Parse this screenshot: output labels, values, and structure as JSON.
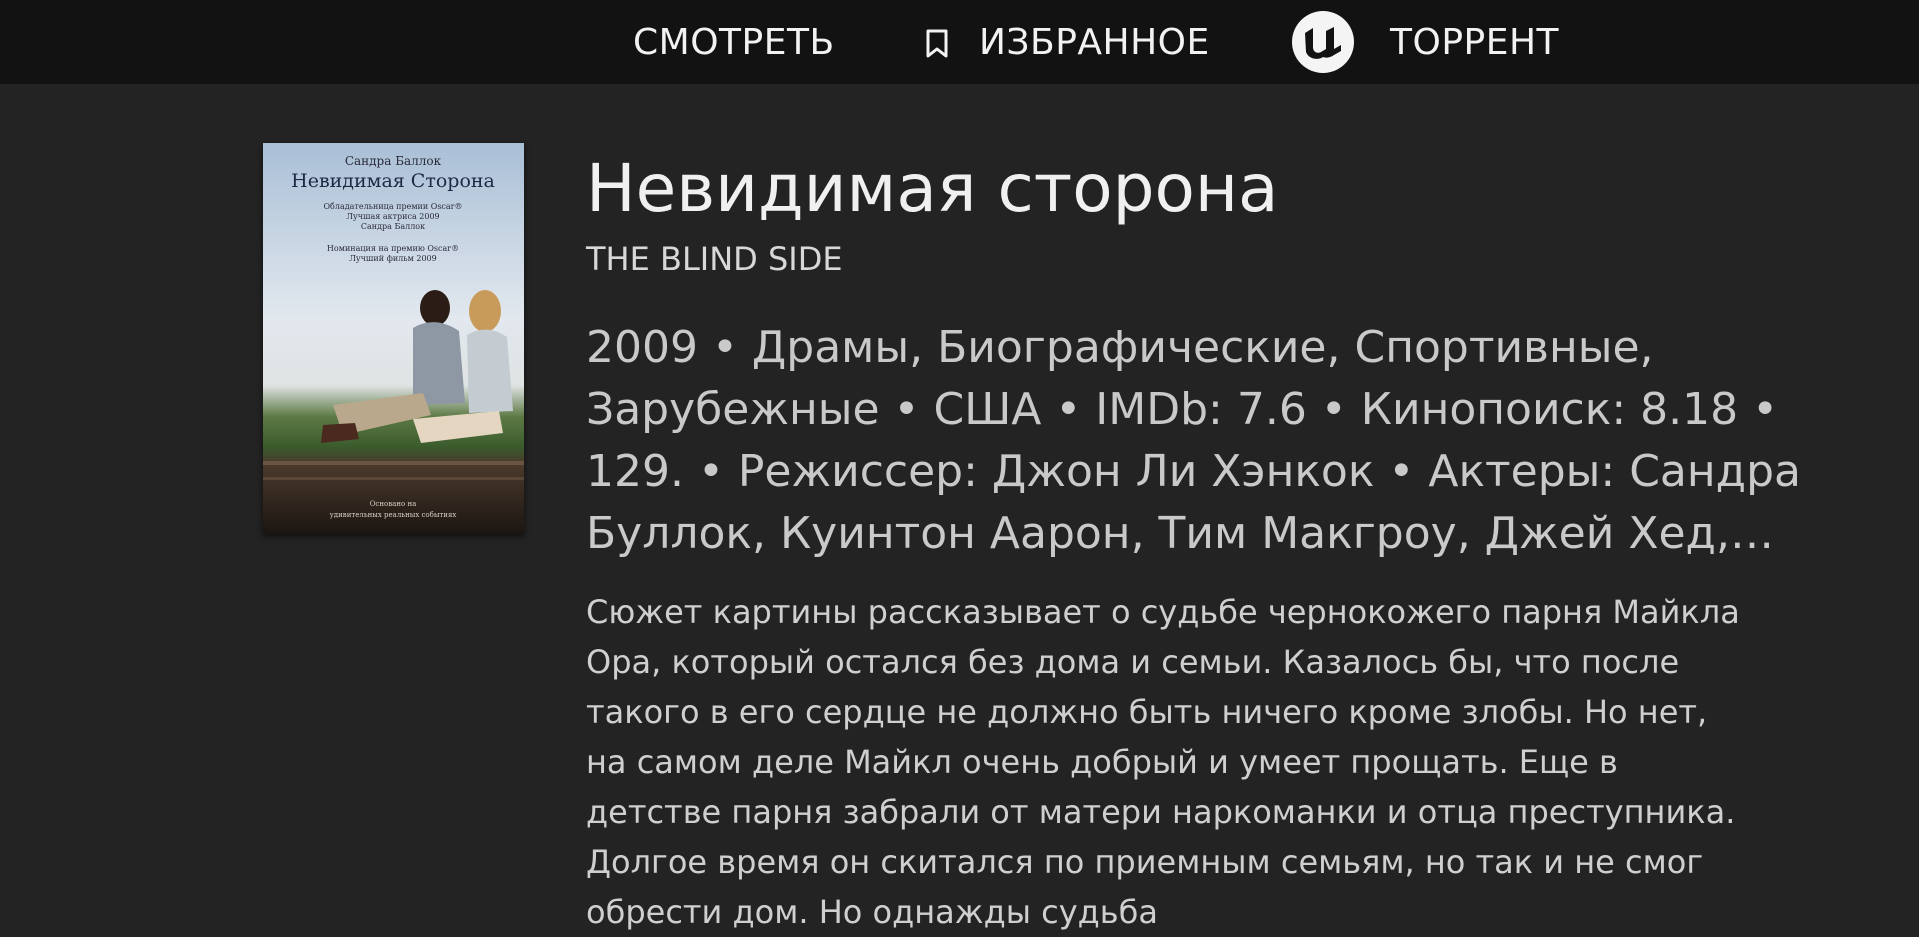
{
  "nav": {
    "watch_label": "СМОТРЕТЬ",
    "favorites_label": "ИЗБРАННОЕ",
    "torrent_label": "ТОРРЕНТ"
  },
  "icons": {
    "favorites": "bookmark-icon",
    "torrent": "utorrent-icon"
  },
  "colors": {
    "background": "#232323",
    "topbar": "#121212",
    "text": "#e8e8e8"
  },
  "poster": {
    "actor": "Сандра Баллок",
    "title": "Невидимая Сторона",
    "award_line1": "Обладательница премии Oscar®",
    "award_line2": "Лучшая актриса 2009",
    "award_line3": "Сандра Баллок",
    "nomination_line1": "Номинация на премию Oscar®",
    "nomination_line2": "Лучший фильм 2009",
    "footer_line1": "Основано на",
    "footer_line2": "удивительных реальных событиях"
  },
  "movie": {
    "title": "Невидимая сторона",
    "original_title": "THE BLIND SIDE",
    "meta": "2009 • Драмы, Биографические, Спортивные, Зарубежные • США • IMDb: 7.6 • Кинопоиск: 8.18 • 129. • Режиссер: Джон Ли Хэнкок • Актеры: Сандра Буллок, Куинтон Аарон, Тим Макгроу, Джей Хед, Лили Коллинз",
    "description": "Сюжет картины рассказывает о судьбе чернокожего парня Майкла Ора, который остался без дома и семьи. Казалось бы, что после такого в его сердце не должно быть ничего кроме злобы. Но нет, на самом деле Майкл очень добрый и умеет прощать. Еще в детстве парня забрали от матери наркоманки и отца преступника. Долгое время он скитался по приемным семьям, но так и не смог обрести дом. Но однажды судьба"
  }
}
